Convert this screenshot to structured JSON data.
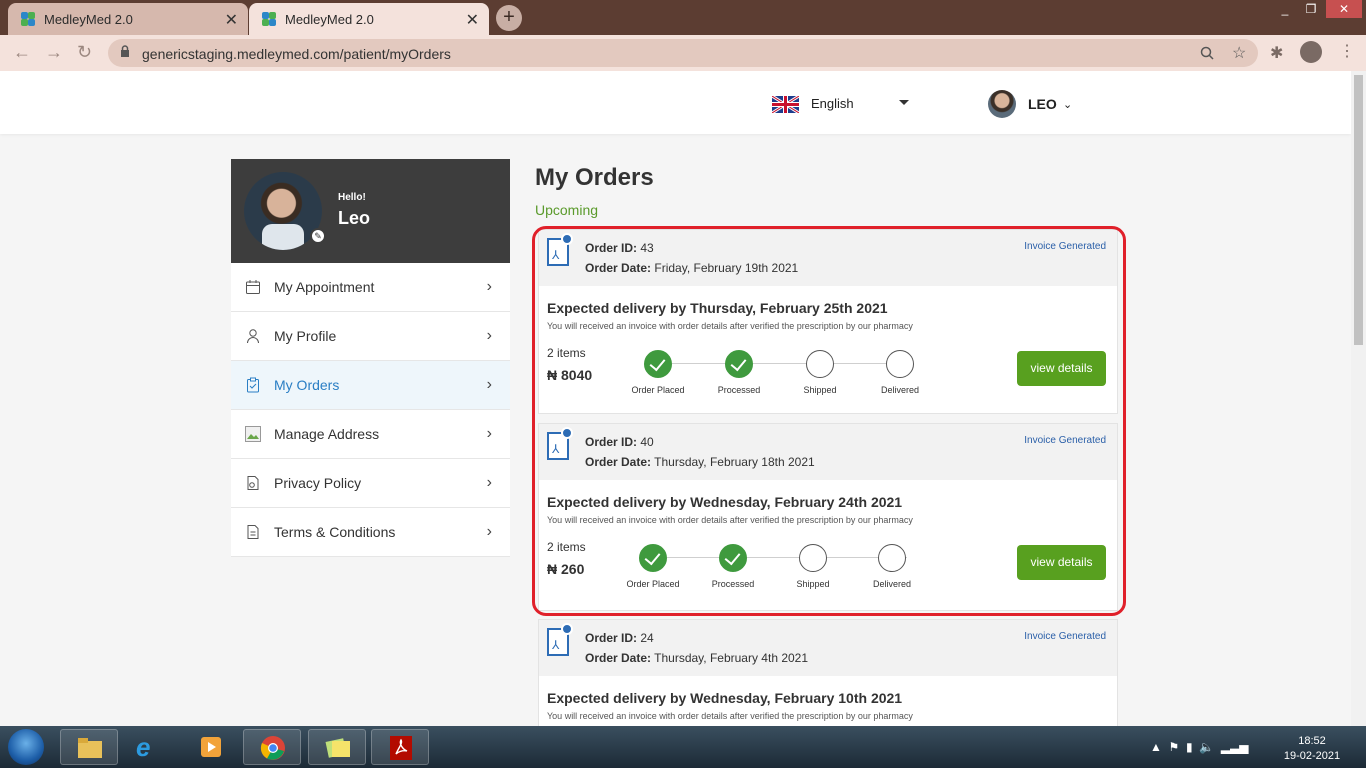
{
  "browser": {
    "tabs": [
      {
        "title": "MedleyMed 2.0",
        "active": false
      },
      {
        "title": "MedleyMed 2.0",
        "active": true
      }
    ],
    "new_tab": "+",
    "url": "genericstaging.medleymed.com/patient/myOrders",
    "window_controls": [
      "_",
      "❐",
      "✕"
    ]
  },
  "header": {
    "language": "English",
    "user_name": "LEO"
  },
  "profile": {
    "greeting": "Hello!",
    "name": "Leo"
  },
  "menu": {
    "items": [
      {
        "label": "My Appointment",
        "icon": "calendar-icon",
        "active": false
      },
      {
        "label": "My Profile",
        "icon": "user-icon",
        "active": false
      },
      {
        "label": "My Orders",
        "icon": "clipboard-icon",
        "active": true
      },
      {
        "label": "Manage Address",
        "icon": "image-placeholder-icon",
        "active": false
      },
      {
        "label": "Privacy Policy",
        "icon": "privacy-icon",
        "active": false
      },
      {
        "label": "Terms & Conditions",
        "icon": "document-icon",
        "active": false
      }
    ]
  },
  "main": {
    "title": "My Orders",
    "section": "Upcoming",
    "labels": {
      "order_id": "Order ID:",
      "order_date": "Order Date:",
      "invoice": "Invoice Generated",
      "note": "You will received an invoice with order details after verified the prescription by our pharmacy",
      "view_details": "view details"
    },
    "steps": [
      "Order Placed",
      "Processed",
      "Shipped",
      "Delivered"
    ],
    "orders": [
      {
        "id": "43",
        "date": "Friday, February 19th 2021",
        "expected": "Expected delivery by Thursday, February 25th 2021",
        "items": "2 items",
        "price": "₦ 8040",
        "completed_steps": 2
      },
      {
        "id": "40",
        "date": "Thursday, February 18th 2021",
        "expected": "Expected delivery by Wednesday, February 24th 2021",
        "items": "2 items",
        "price": "₦ 260",
        "completed_steps": 2
      },
      {
        "id": "24",
        "date": "Thursday, February 4th 2021",
        "expected": "Expected delivery by Wednesday, February 10th 2021"
      }
    ]
  },
  "taskbar": {
    "time": "18:52",
    "date": "19-02-2021"
  },
  "colors": {
    "accent_green": "#58a01f",
    "step_done": "#3f9a3e",
    "active_menu": "#2a7ec4",
    "highlight": "#e0202a",
    "browser_frame": "#5c3d32"
  }
}
